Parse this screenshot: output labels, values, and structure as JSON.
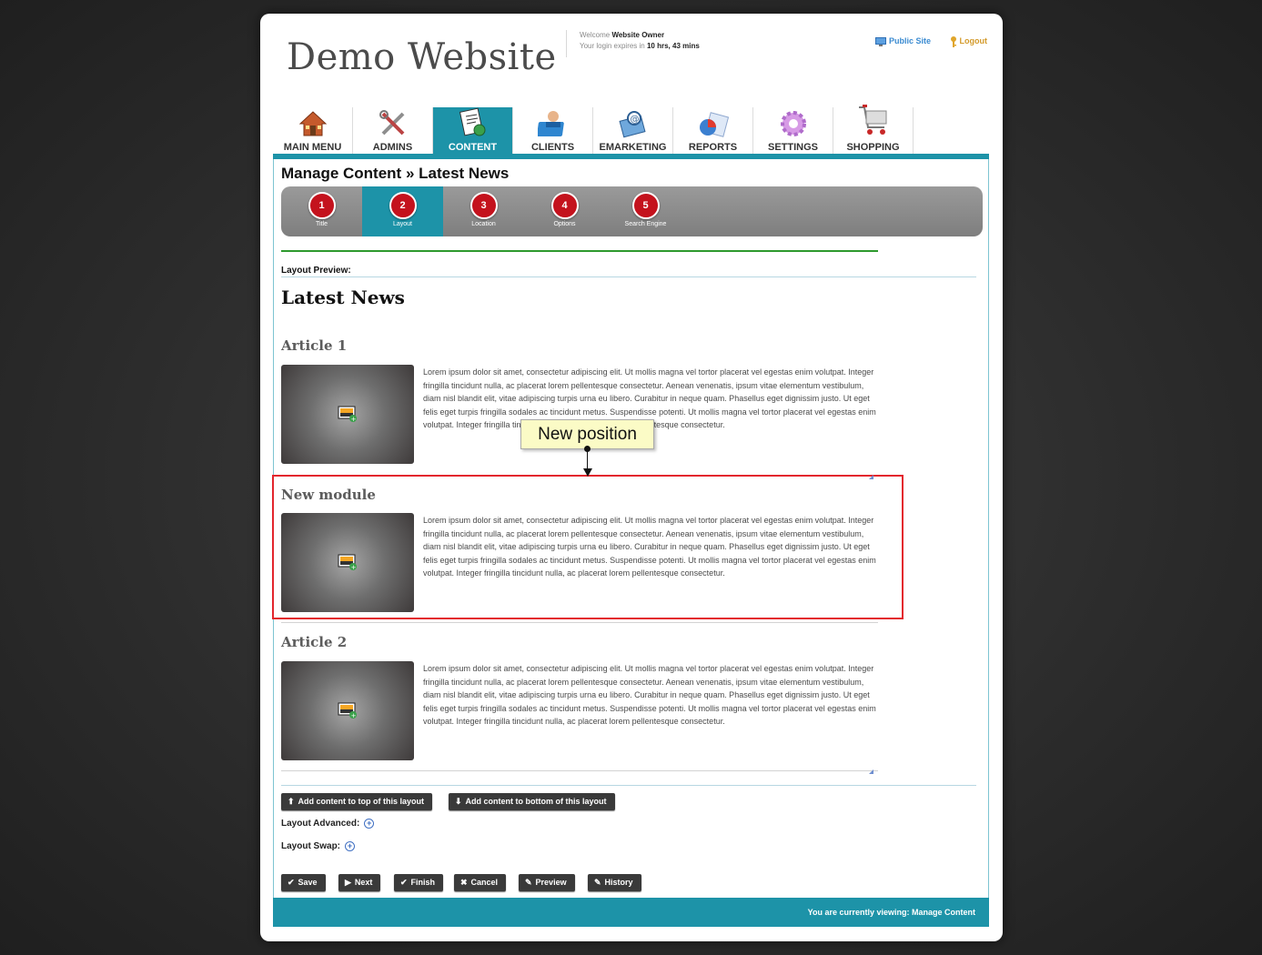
{
  "site": {
    "logo": "Demo Website"
  },
  "welcome": {
    "prefix": "Welcome",
    "user": "Website Owner",
    "expires_prefix": "Your login expires in",
    "expires_value": "10 hrs, 43 mins"
  },
  "toplinks": {
    "public_site": "Public Site",
    "logout": "Logout"
  },
  "nav": {
    "tabs": [
      {
        "label": "MAIN MENU",
        "icon": "house-icon"
      },
      {
        "label": "ADMINS",
        "icon": "tools-icon"
      },
      {
        "label": "CONTENT",
        "icon": "content-document-icon",
        "active": true
      },
      {
        "label": "CLIENTS",
        "icon": "folder-person-icon"
      },
      {
        "label": "EMARKETING",
        "icon": "email-icon"
      },
      {
        "label": "REPORTS",
        "icon": "pie-chart-report-icon"
      },
      {
        "label": "SETTINGS",
        "icon": "gear-icon"
      },
      {
        "label": "SHOPPING",
        "icon": "shopping-cart-icon"
      }
    ]
  },
  "page": {
    "title": "Manage Content » Latest News"
  },
  "steps": [
    {
      "num": "1",
      "label": "Title"
    },
    {
      "num": "2",
      "label": "Layout",
      "active": true
    },
    {
      "num": "3",
      "label": "Location"
    },
    {
      "num": "4",
      "label": "Options"
    },
    {
      "num": "5",
      "label": "Search Engine"
    }
  ],
  "preview": {
    "label": "Layout Preview:",
    "heading": "Latest News",
    "articles": [
      {
        "title": "Article 1",
        "text": "Lorem ipsum dolor sit amet, consectetur adipiscing elit. Ut mollis magna vel tortor placerat vel egestas enim volutpat. Integer fringilla tincidunt nulla, ac placerat lorem pellentesque consectetur. Aenean venenatis, ipsum vitae elementum vestibulum, diam nisl blandit elit, vitae adipiscing turpis urna eu libero. Curabitur in neque quam. Phasellus eget dignissim justo. Ut eget felis eget turpis fringilla sodales ac tincidunt metus. Suspendisse potenti. Ut mollis magna vel tortor placerat vel egestas enim volutpat. Integer fringilla tincidunt nulla, ac placerat lorem pellentesque consectetur."
      },
      {
        "title": "New module",
        "text": "Lorem ipsum dolor sit amet, consectetur adipiscing elit. Ut mollis magna vel tortor placerat vel egestas enim volutpat. Integer fringilla tincidunt nulla, ac placerat lorem pellentesque consectetur. Aenean venenatis, ipsum vitae elementum vestibulum, diam nisl blandit elit, vitae adipiscing turpis urna eu libero. Curabitur in neque quam. Phasellus eget dignissim justo. Ut eget felis eget turpis fringilla sodales ac tincidunt metus. Suspendisse potenti. Ut mollis magna vel tortor placerat vel egestas enim volutpat. Integer fringilla tincidunt nulla, ac placerat lorem pellentesque consectetur."
      },
      {
        "title": "Article 2",
        "text": "Lorem ipsum dolor sit amet, consectetur adipiscing elit. Ut mollis magna vel tortor placerat vel egestas enim volutpat. Integer fringilla tincidunt nulla, ac placerat lorem pellentesque consectetur. Aenean venenatis, ipsum vitae elementum vestibulum, diam nisl blandit elit, vitae adipiscing turpis urna eu libero. Curabitur in neque quam. Phasellus eget dignissim justo. Ut eget felis eget turpis fringilla sodales ac tincidunt metus. Suspendisse potenti. Ut mollis magna vel tortor placerat vel egestas enim volutpat. Integer fringilla tincidunt nulla, ac placerat lorem pellentesque consectetur."
      }
    ],
    "tooltip": "New position"
  },
  "actions": {
    "add_top": "Add content to top of this layout",
    "add_bottom": "Add content to bottom of this layout"
  },
  "options": {
    "layout_advanced": "Layout Advanced:",
    "layout_swap": "Layout Swap:"
  },
  "buttons": {
    "save": "Save",
    "next": "Next",
    "finish": "Finish",
    "cancel": "Cancel",
    "preview": "Preview",
    "history": "History"
  },
  "footer": {
    "status": "You are currently viewing: Manage Content"
  },
  "colors": {
    "teal": "#1d93a8",
    "step_red": "#c4121d",
    "highlight_red": "#e3262d"
  }
}
